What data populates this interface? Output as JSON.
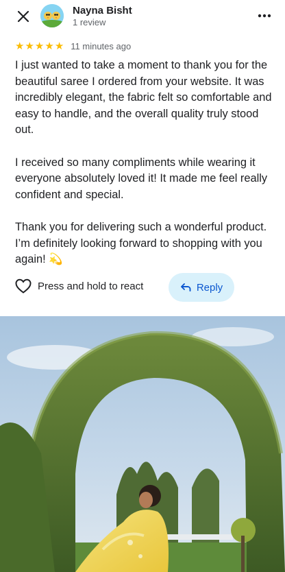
{
  "header": {
    "reviewer_name": "Nayna Bisht",
    "review_count": "1 review",
    "close_icon": "close-icon",
    "more_icon": "more-options-icon",
    "avatar_icon": "birds-avatar"
  },
  "rating": {
    "stars": 5,
    "max": 5,
    "star_color": "#fbbc04",
    "time_ago": "11 minutes ago"
  },
  "review": {
    "paragraphs": [
      "I just wanted to take a moment to thank you for the beautiful saree I ordered from your website. It was incredibly elegant, the fabric felt so comfortable and easy to handle, and the overall quality truly stood out.",
      "I received so many compliments while wearing it everyone absolutely loved it! It made me feel really confident and special.",
      "Thank you for delivering such a wonderful product. I’m definitely looking forward to shopping with you again! 💫"
    ]
  },
  "actions": {
    "react_label": "Press and hold to react",
    "react_icon": "heart-icon",
    "reply_label": "Reply",
    "reply_icon": "reply-arrow-icon",
    "reply_bg": "#d9f1fb",
    "reply_color": "#0b57d0"
  },
  "photo": {
    "description_icon": "review-photo"
  }
}
